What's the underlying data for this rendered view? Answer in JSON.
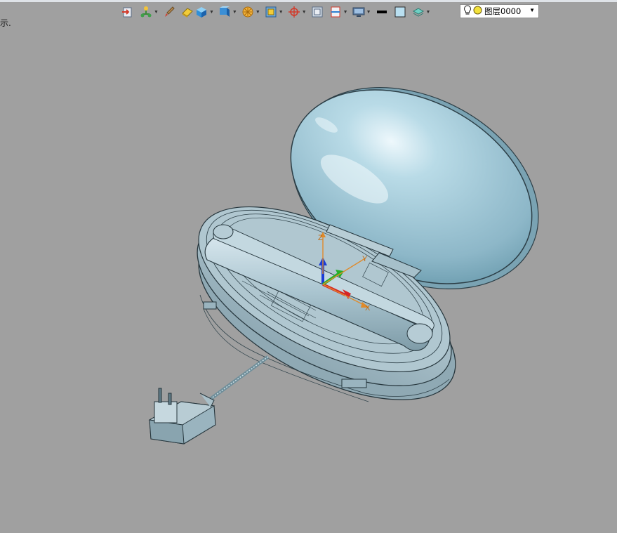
{
  "status_hint": "示.",
  "toolbar": {
    "buttons": [
      {
        "icon": "open-file-icon",
        "has_dropdown": false
      },
      {
        "icon": "render-tree-icon",
        "has_dropdown": true
      },
      {
        "icon": "paint-brush-icon",
        "has_dropdown": false
      },
      {
        "icon": "eraser-icon",
        "has_dropdown": false
      },
      {
        "icon": "shaded-cube-icon",
        "has_dropdown": true
      },
      {
        "icon": "view-orient-icon",
        "has_dropdown": true
      },
      {
        "icon": "section-view-icon",
        "has_dropdown": true
      },
      {
        "icon": "display-mode-icon",
        "has_dropdown": true
      },
      {
        "icon": "csys-icon",
        "has_dropdown": true
      },
      {
        "icon": "frame-icon",
        "has_dropdown": false
      },
      {
        "icon": "window-split-icon",
        "has_dropdown": true
      },
      {
        "icon": "monitor-icon",
        "has_dropdown": true
      },
      {
        "icon": "line-style-icon",
        "has_dropdown": false
      },
      {
        "icon": "color-swatch-icon",
        "has_dropdown": false
      },
      {
        "icon": "layers-icon",
        "has_dropdown": true
      }
    ],
    "accent": "#2c7fd1"
  },
  "layer_combo": {
    "value": "图层0000",
    "bulb_icon": "lightbulb-icon",
    "visibility_icon": "yellow-dot-icon"
  },
  "viewport": {
    "background": "#a0a0a0",
    "model_color": "#a9c4cf",
    "triad": {
      "x_label": "X",
      "y_label": "Y",
      "z_label": "Z"
    }
  }
}
